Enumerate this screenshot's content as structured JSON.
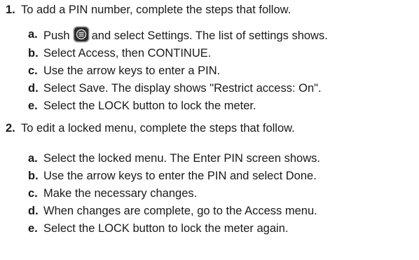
{
  "steps": [
    {
      "number": "1.",
      "text": "To add a PIN number, complete the steps that follow.",
      "substeps": [
        {
          "letter": "a.",
          "before_icon": "Push",
          "icon": "menu-button-icon",
          "after_icon": "and select Settings. The list of settings shows."
        },
        {
          "letter": "b.",
          "text": "Select Access, then CONTINUE."
        },
        {
          "letter": "c.",
          "text": "Use the arrow keys to enter a PIN."
        },
        {
          "letter": "d.",
          "text": "Select Save. The display shows \"Restrict access: On\"."
        },
        {
          "letter": "e.",
          "text": "Select the LOCK button to lock the meter."
        }
      ]
    },
    {
      "number": "2.",
      "text": "To edit a locked menu, complete the steps that follow.",
      "substeps": [
        {
          "letter": "a.",
          "text": "Select the locked menu. The Enter PIN screen shows."
        },
        {
          "letter": "b.",
          "text": "Use the arrow keys to enter the PIN and select Done."
        },
        {
          "letter": "c.",
          "text": "Make the necessary changes."
        },
        {
          "letter": "d.",
          "text": "When changes are complete, go to the Access menu."
        },
        {
          "letter": "e.",
          "text": "Select the LOCK button to lock the meter again."
        }
      ]
    }
  ],
  "colors": {
    "text": "#1a1a1a",
    "icon_body": "#2b2b2b",
    "icon_rim": "#9a9a9a"
  }
}
